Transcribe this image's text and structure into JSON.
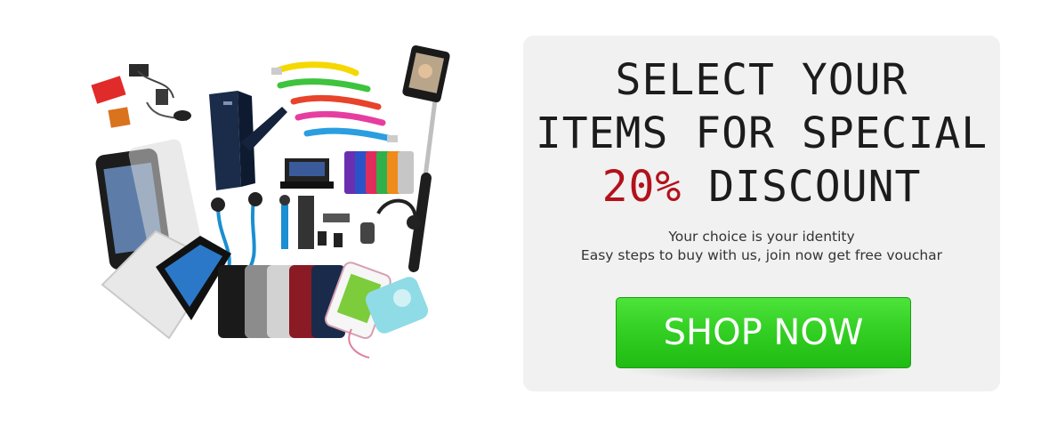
{
  "collage": {
    "icons": [
      "chargers-icon",
      "flip-case-icon",
      "usb-cables-icon",
      "selfie-stick-icon",
      "phone-icon",
      "phone-cases-icon",
      "earphones-icon",
      "docking-station-icon",
      "headset-icon",
      "screen-protector-icon",
      "power-bank-icon"
    ]
  },
  "promo": {
    "headline_line1": "SELECT YOUR",
    "headline_line2": "ITEMS FOR SPECIAL",
    "discount_amount": "20%",
    "discount_word": "DISCOUNT",
    "tagline_line1": "Your choice is your identity",
    "tagline_line2": "Easy steps to buy with us, join now get free vouchar",
    "cta_label": "SHOP NOW"
  },
  "colors": {
    "accent_red": "#b3121b",
    "cta_green": "#34d024",
    "panel_bg": "#f1f1f1"
  }
}
